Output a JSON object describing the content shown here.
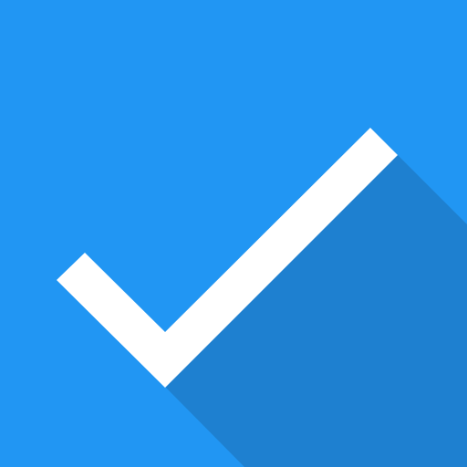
{
  "icon": {
    "name": "checkmark-icon",
    "colors": {
      "background": "#2196F3",
      "shadow": "#1E80D0",
      "check": "#FFFFFF"
    }
  }
}
